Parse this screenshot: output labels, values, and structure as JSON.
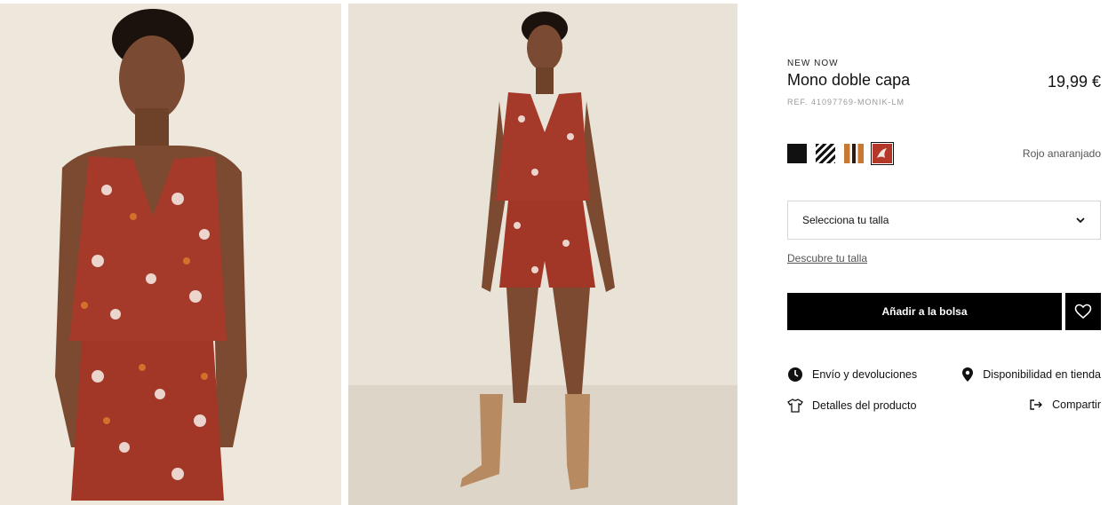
{
  "product": {
    "label": "NEW NOW",
    "title": "Mono doble capa",
    "price": "19,99 €",
    "reference": "REF. 41097769-MONIK-LM"
  },
  "colors": {
    "selected_name": "Rojo anaranjado",
    "swatches": [
      {
        "name": "black-swatch",
        "color": "#111111"
      },
      {
        "name": "black-white-print-swatch",
        "color": "#222222"
      },
      {
        "name": "orange-stripe-swatch",
        "color": "#c9792f"
      },
      {
        "name": "red-orange-print-swatch",
        "color": "#b5372a",
        "selected": true
      }
    ]
  },
  "size": {
    "placeholder": "Selecciona tu talla",
    "guide_link": "Descubre tu talla"
  },
  "actions": {
    "add_to_bag": "Añadir a la bolsa",
    "shipping": "Envío y devoluciones",
    "availability": "Disponibilidad en tienda",
    "details": "Detalles del producto",
    "share": "Compartir"
  }
}
